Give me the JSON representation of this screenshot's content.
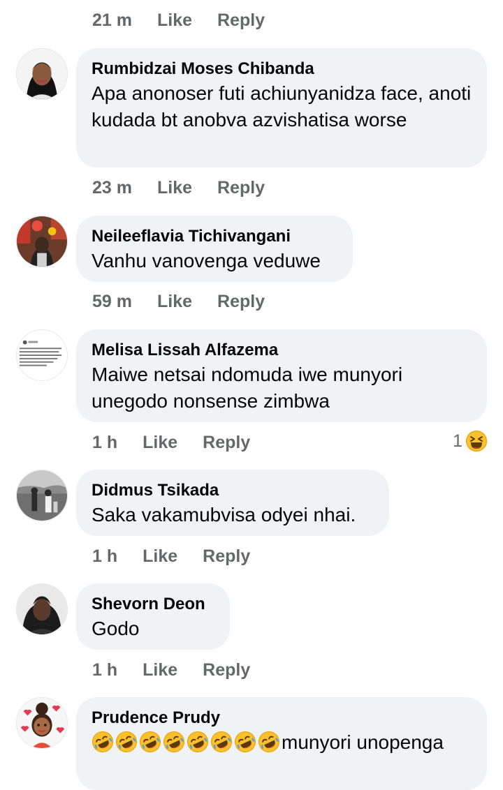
{
  "labels": {
    "like": "Like",
    "reply": "Reply"
  },
  "top_actions": {
    "time": "21 m"
  },
  "comments": [
    {
      "name": "Rumbidzai Moses Chibanda",
      "text": "Apa anonoser futi achiunyanidza face, anoti kudada bt anobva azvishatisa worse",
      "time": "23 m"
    },
    {
      "name": "Neileeflavia Tichivangani",
      "text": "Vanhu vanovenga veduwe",
      "time": "59 m"
    },
    {
      "name": "Melisa Lissah Alfazema",
      "text": "Maiwe netsai ndomuda iwe munyori unegodo nonsense zimbwa",
      "time": "1 h",
      "reaction": {
        "count": "1",
        "icon": "laughing-face-emoji"
      }
    },
    {
      "name": "Didmus Tsikada",
      "text": "Saka vakamubvisa odyei nhai.",
      "time": "1 h"
    },
    {
      "name": "Shevorn Deon",
      "text": "Godo",
      "time": "1 h"
    },
    {
      "name": "Prudence Prudy",
      "emoji_prefix": {
        "icon": "rolling-on-floor-laughing-emoji",
        "count": 8
      },
      "text": "munyori unopenga"
    }
  ],
  "colors": {
    "bubble": "#f0f2f5",
    "meta_text": "#65676b",
    "body_text": "#050505",
    "emoji_yellow": "#fbc02d"
  }
}
